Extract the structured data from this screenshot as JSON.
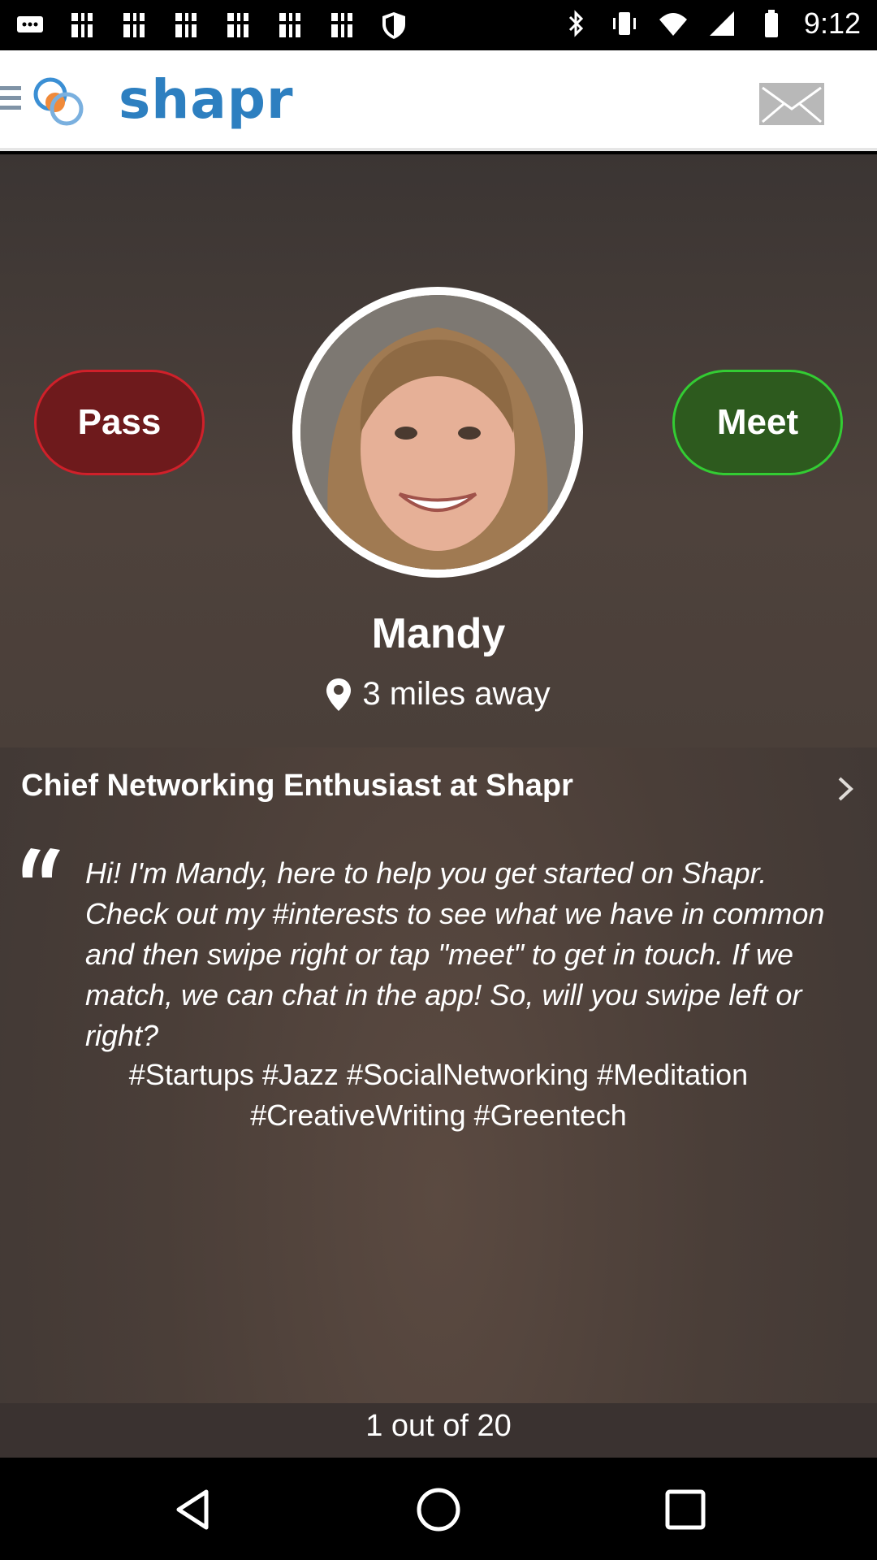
{
  "status_bar": {
    "time": "9:12"
  },
  "header": {
    "brand": "shapr"
  },
  "profile": {
    "pass_label": "Pass",
    "meet_label": "Meet",
    "name": "Mandy",
    "distance": "3 miles away",
    "job_title": "Chief Networking Enthusiast at Shapr",
    "bio": "Hi! I'm Mandy, here to help you get started on Shapr. Check out my #interests to see what we have in common and then swipe right or tap \"meet\" to get in touch. If we match, we can chat in the app! So, will you swipe left or right?",
    "tags": "#Startups #Jazz #SocialNetworking #Meditation #CreativeWriting #Greentech"
  },
  "counter": {
    "text": "1 out of 20"
  },
  "colors": {
    "brand": "#2d7fc0",
    "pass": "#d0202a",
    "meet": "#33cc33"
  }
}
